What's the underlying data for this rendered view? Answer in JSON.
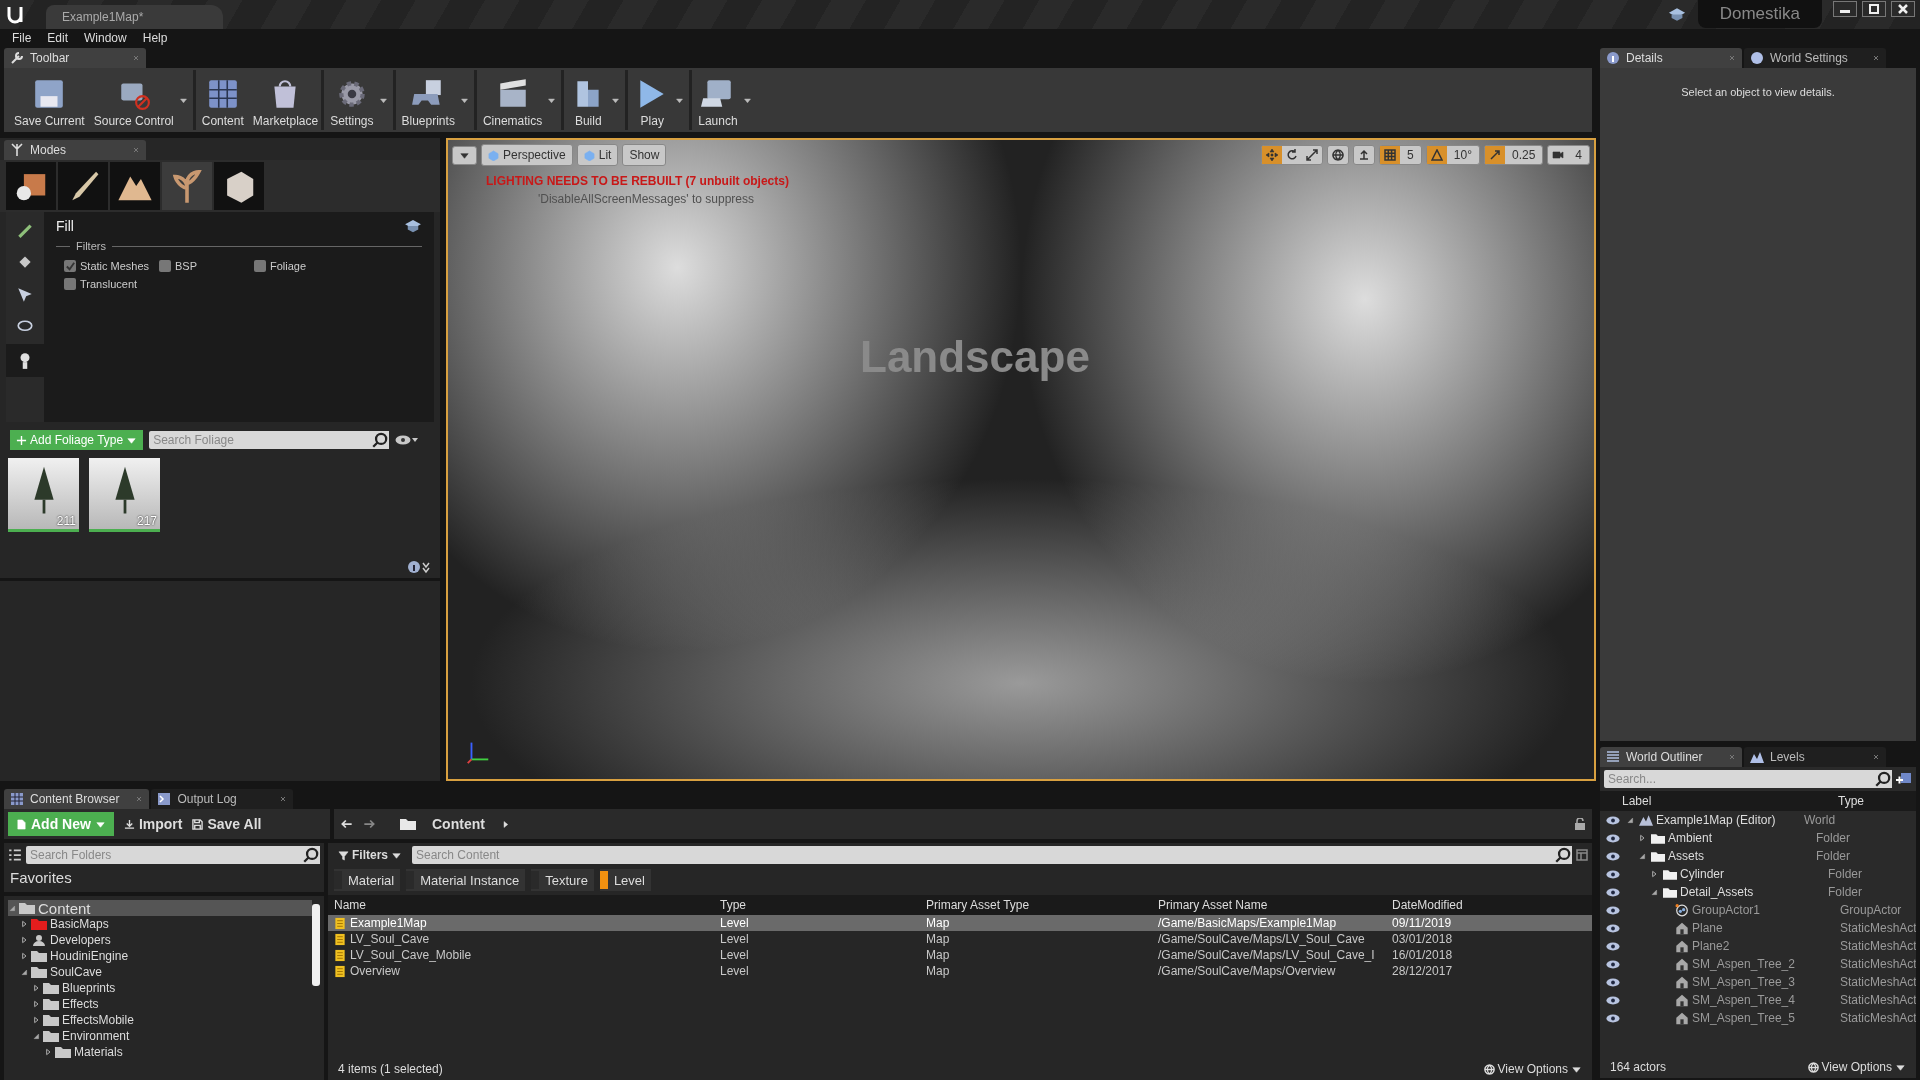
{
  "title_bar": {
    "document_tab": "Example1Map*",
    "project": "Domestika"
  },
  "menu": [
    "File",
    "Edit",
    "Window",
    "Help"
  ],
  "toolbar": {
    "tab": "Toolbar",
    "buttons": [
      {
        "label": "Save Current",
        "kind": "save",
        "has_menu": false,
        "separator_before": false
      },
      {
        "label": "Source Control",
        "kind": "source",
        "has_menu": true,
        "separator_before": false
      },
      {
        "label": "Content",
        "kind": "content",
        "has_menu": false,
        "separator_before": true
      },
      {
        "label": "Marketplace",
        "kind": "market",
        "has_menu": false,
        "separator_before": false
      },
      {
        "label": "Settings",
        "kind": "settings",
        "has_menu": true,
        "separator_before": true
      },
      {
        "label": "Blueprints",
        "kind": "blueprints",
        "has_menu": true,
        "separator_before": true
      },
      {
        "label": "Cinematics",
        "kind": "cinematics",
        "has_menu": true,
        "separator_before": true
      },
      {
        "label": "Build",
        "kind": "build",
        "has_menu": true,
        "separator_before": true
      },
      {
        "label": "Play",
        "kind": "play",
        "has_menu": true,
        "separator_before": true
      },
      {
        "label": "Launch",
        "kind": "launch",
        "has_menu": true,
        "separator_before": true
      }
    ]
  },
  "modes": {
    "tab": "Modes",
    "mode_tabs": [
      {
        "kind": "place",
        "selected": false
      },
      {
        "kind": "paint",
        "selected": false
      },
      {
        "kind": "landscape",
        "selected": false
      },
      {
        "kind": "foliage",
        "selected": true
      },
      {
        "kind": "geometry",
        "selected": false
      }
    ],
    "tools": [
      {
        "kind": "brush",
        "selected": false
      },
      {
        "kind": "bucket",
        "selected": false
      },
      {
        "kind": "select",
        "selected": false
      },
      {
        "kind": "lasso",
        "selected": false
      },
      {
        "kind": "fill",
        "selected": true
      }
    ],
    "tool_title": "Fill",
    "filters_label": "Filters",
    "filters": [
      {
        "label": "Static Meshes",
        "checked": true
      },
      {
        "label": "BSP",
        "checked": false
      },
      {
        "label": "Foliage",
        "checked": false
      },
      {
        "label": "Translucent",
        "checked": false
      }
    ],
    "add_button": "Add Foliage Type",
    "search": {
      "placeholder": "Search Foliage"
    },
    "foliage": [
      {
        "count": "211"
      },
      {
        "count": "217"
      }
    ]
  },
  "viewport": {
    "view_mode": "Perspective",
    "lighting": "Lit",
    "show": "Show",
    "warning": "LIGHTING NEEDS TO BE REBUILT (7 unbuilt objects)",
    "hint": "'DisableAllScreenMessages' to suppress",
    "actor_label": "Landscape",
    "transform_tools": [
      {
        "kind": "translate",
        "selected": true
      },
      {
        "kind": "rotate",
        "selected": false
      },
      {
        "kind": "scale",
        "selected": false
      }
    ],
    "snaps": [
      {
        "kind": "grid",
        "on": true,
        "value": "5"
      },
      {
        "kind": "angle",
        "on": true,
        "value": "10°"
      },
      {
        "kind": "scale",
        "on": true,
        "value": "0.25"
      }
    ],
    "camera_speed": "4"
  },
  "details": {
    "tabs": [
      {
        "label": "Details",
        "selected": true
      },
      {
        "label": "World Settings",
        "selected": false
      }
    ],
    "message": "Select an object to view details."
  },
  "content_browser": {
    "tabs": [
      {
        "label": "Content Browser",
        "selected": true
      },
      {
        "label": "Output Log",
        "selected": false
      }
    ],
    "add_new": "Add New",
    "import": "Import",
    "save_all": "Save All",
    "path": "Content",
    "folder_search": {
      "placeholder": "Search Folders"
    },
    "favorites": "Favorites",
    "folders": [
      {
        "label": "Content",
        "kind": "folder",
        "color": "#c8c8c8",
        "selected": true,
        "expanded": true,
        "children": [
          {
            "label": "BasicMaps",
            "kind": "folder",
            "color": "#e41d1d",
            "selected": false,
            "expanded": false
          },
          {
            "label": "Developers",
            "kind": "user",
            "color": "#c8c8c8",
            "selected": false,
            "expanded": false
          },
          {
            "label": "HoudiniEngine",
            "kind": "folder",
            "color": "#c8c8c8",
            "selected": false,
            "expanded": false
          },
          {
            "label": "SoulCave",
            "kind": "folder",
            "color": "#c8c8c8",
            "selected": false,
            "expanded": true,
            "children": [
              {
                "label": "Blueprints",
                "kind": "folder",
                "color": "#c8c8c8",
                "selected": false,
                "expanded": false
              },
              {
                "label": "Effects",
                "kind": "folder",
                "color": "#c8c8c8",
                "selected": false,
                "expanded": false
              },
              {
                "label": "EffectsMobile",
                "kind": "folder",
                "color": "#c8c8c8",
                "selected": false,
                "expanded": false
              },
              {
                "label": "Environment",
                "kind": "folder",
                "color": "#c8c8c8",
                "selected": false,
                "expanded": true,
                "children": [
                  {
                    "label": "Materials",
                    "kind": "folder",
                    "color": "#c8c8c8",
                    "selected": false,
                    "expanded": false
                  }
                ]
              }
            ]
          }
        ]
      }
    ],
    "filters_button": "Filters",
    "content_search": {
      "placeholder": "Search Content"
    },
    "filter_chips": [
      {
        "label": "Material",
        "selected": false
      },
      {
        "label": "Material Instance",
        "selected": false
      },
      {
        "label": "Texture",
        "selected": false
      },
      {
        "label": "Level",
        "selected": true
      }
    ],
    "table": {
      "columns": [
        "Name",
        "Type",
        "Primary Asset Type",
        "Primary Asset Name",
        "DateModified"
      ],
      "rows": [
        {
          "cells": [
            "Example1Map",
            "Level",
            "Map",
            "/Game/BasicMaps/Example1Map",
            "09/11/2019"
          ],
          "selected": true
        },
        {
          "cells": [
            "LV_Soul_Cave",
            "Level",
            "Map",
            "/Game/SoulCave/Maps/LV_Soul_Cave",
            "03/01/2018"
          ],
          "selected": false
        },
        {
          "cells": [
            "LV_Soul_Cave_Mobile",
            "Level",
            "Map",
            "/Game/SoulCave/Maps/LV_Soul_Cave_I",
            "16/01/2018"
          ],
          "selected": false
        },
        {
          "cells": [
            "Overview",
            "Level",
            "Map",
            "/Game/SoulCave/Maps/Overview",
            "28/12/2017"
          ],
          "selected": false
        }
      ]
    },
    "status": "4 items (1 selected)",
    "view_options": "View Options"
  },
  "world_outliner": {
    "tabs": [
      {
        "label": "World Outliner",
        "selected": true
      },
      {
        "label": "Levels",
        "selected": false
      }
    ],
    "search": {
      "placeholder": "Search..."
    },
    "columns": [
      "Label",
      "Type"
    ],
    "tree": [
      {
        "label": "Example1Map (Editor)",
        "type": "World",
        "kind": "world",
        "expanded": true,
        "children": [
          {
            "label": "Ambient",
            "type": "Folder",
            "kind": "folder",
            "expanded": false
          },
          {
            "label": "Assets",
            "type": "Folder",
            "kind": "folder",
            "expanded": true,
            "children": [
              {
                "label": "Cylinder",
                "type": "Folder",
                "kind": "folder",
                "expanded": false
              },
              {
                "label": "Detail_Assets",
                "type": "Folder",
                "kind": "folder",
                "expanded": true,
                "children": [
                  {
                    "label": "GroupActor1",
                    "type": "GroupActor",
                    "kind": "group"
                  },
                  {
                    "label": "Plane",
                    "type": "StaticMeshAct",
                    "kind": "mesh"
                  },
                  {
                    "label": "Plane2",
                    "type": "StaticMeshAct",
                    "kind": "mesh"
                  },
                  {
                    "label": "SM_Aspen_Tree_2",
                    "type": "StaticMeshAct",
                    "kind": "mesh"
                  },
                  {
                    "label": "SM_Aspen_Tree_3",
                    "type": "StaticMeshAct",
                    "kind": "mesh"
                  },
                  {
                    "label": "SM_Aspen_Tree_4",
                    "type": "StaticMeshAct",
                    "kind": "mesh"
                  },
                  {
                    "label": "SM_Aspen_Tree_5",
                    "type": "StaticMeshAct",
                    "kind": "mesh"
                  }
                ]
              }
            ]
          }
        ]
      }
    ],
    "status": "164 actors",
    "view_options": "View Options"
  }
}
